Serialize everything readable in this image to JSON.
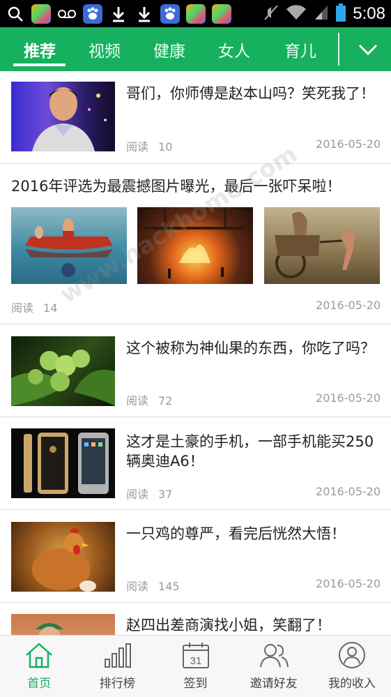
{
  "status_bar": {
    "time": "5:08",
    "icons": [
      "search-icon",
      "app-icon",
      "voicemail-icon",
      "baidu-icon",
      "download-icon",
      "download-icon",
      "baidu-icon",
      "app-icon",
      "app-icon"
    ],
    "right_icons": [
      "mute-icon",
      "wifi-icon",
      "signal-icon",
      "battery-icon"
    ]
  },
  "tabs": {
    "items": [
      {
        "label": "推荐",
        "active": true
      },
      {
        "label": "视频",
        "active": false
      },
      {
        "label": "健康",
        "active": false
      },
      {
        "label": "女人",
        "active": false
      },
      {
        "label": "育儿",
        "active": false
      }
    ],
    "more_icon": "chevron-down-icon",
    "accent": "#17b05f"
  },
  "feed": {
    "read_label": "阅读",
    "items": [
      {
        "title": "哥们，你师傅是赵本山吗？笑死我了！",
        "reads": "10",
        "date": "2016-05-20",
        "image": "man-on-stage-photo"
      },
      {
        "title": "2016年评选为最震撼图片曝光，最后一张吓呆啦！",
        "reads": "14",
        "date": "2016-05-20",
        "images": [
          "boat-reflection-photo",
          "fire-pit-photo",
          "creature-cart-photo"
        ]
      },
      {
        "title": "这个被称为神仙果的东西，你吃了吗？",
        "reads": "72",
        "date": "2016-05-20",
        "image": "green-fruit-photo"
      },
      {
        "title": "这才是土豪的手机，一部手机能买250辆奥迪A6！",
        "reads": "37",
        "date": "2016-05-20",
        "image": "luxury-phones-photo"
      },
      {
        "title": "一只鸡的尊严，看完后恍然大悟！",
        "reads": "145",
        "date": "2016-05-20",
        "image": "hen-photo"
      },
      {
        "title": "赵四出差商演找小姐，笑翻了！",
        "image": "man-in-cap-photo"
      }
    ]
  },
  "watermark": "www.hackhome.com",
  "bottom_nav": {
    "items": [
      {
        "label": "首页",
        "icon": "home-icon",
        "active": true
      },
      {
        "label": "排行榜",
        "icon": "ranking-icon",
        "active": false
      },
      {
        "label": "签到",
        "icon": "calendar-icon",
        "day": "31",
        "active": false
      },
      {
        "label": "邀请好友",
        "icon": "invite-friends-icon",
        "active": false
      },
      {
        "label": "我的收入",
        "icon": "profile-icon",
        "active": false
      }
    ]
  }
}
